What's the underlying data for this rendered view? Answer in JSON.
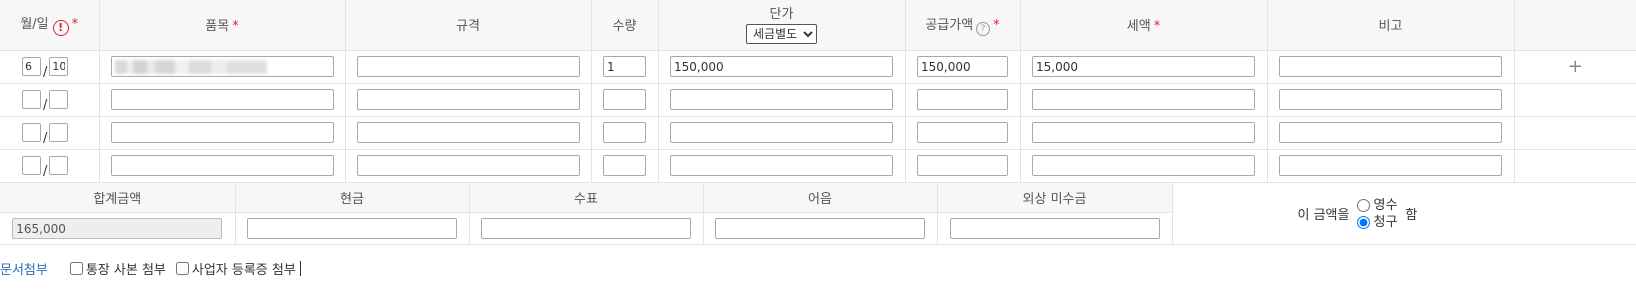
{
  "headers": {
    "date": "월/일",
    "item": "품목",
    "spec": "규격",
    "qty": "수량",
    "unit_price": "단가",
    "supply": "공급가액",
    "tax": "세액",
    "note": "비고",
    "required_mark": "*",
    "alert_glyph": "!",
    "help_glyph": "?",
    "tax_option_selected": "세금별도"
  },
  "rows": [
    {
      "month": "6",
      "day": "10",
      "item": "",
      "spec": "",
      "qty": "1",
      "unit_price": "150,000",
      "supply": "150,000",
      "tax": "15,000",
      "note": ""
    },
    {
      "month": "",
      "day": "",
      "item": "",
      "spec": "",
      "qty": "",
      "unit_price": "",
      "supply": "",
      "tax": "",
      "note": ""
    },
    {
      "month": "",
      "day": "",
      "item": "",
      "spec": "",
      "qty": "",
      "unit_price": "",
      "supply": "",
      "tax": "",
      "note": ""
    },
    {
      "month": "",
      "day": "",
      "item": "",
      "spec": "",
      "qty": "",
      "unit_price": "",
      "supply": "",
      "tax": "",
      "note": ""
    }
  ],
  "date_separator": "/",
  "add_row_glyph": "+",
  "summary": {
    "total_label": "합계금액",
    "cash_label": "현금",
    "check_label": "수표",
    "note_label": "어음",
    "credit_label": "외상 미수금",
    "total_value": "165,000",
    "cash_value": "",
    "check_value": "",
    "bill_value": "",
    "credit_value": "",
    "amount_prefix": "이 금액을",
    "receipt_option": "영수",
    "claim_option": "청구",
    "amount_suffix": "함",
    "selected_option": "청구"
  },
  "attachments": {
    "link_label": "문서첨부",
    "bankbook_label": "통장 사본 첨부",
    "business_reg_label": "사업자 등록증 첨부"
  }
}
